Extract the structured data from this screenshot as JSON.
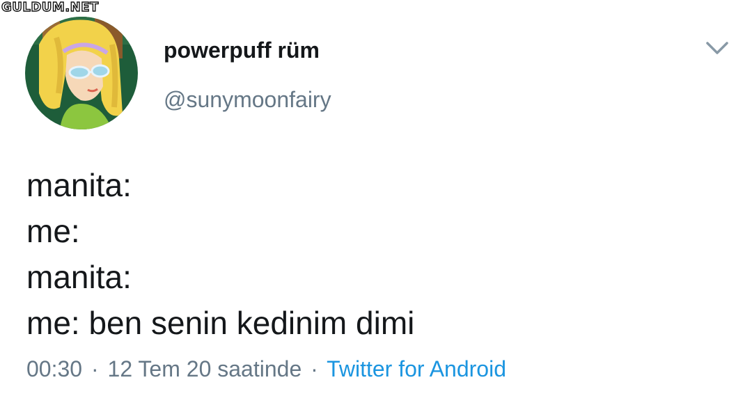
{
  "watermark": {
    "text": "GULDUM.NET"
  },
  "tweet": {
    "author": {
      "display_name": "powerpuff rüm",
      "handle": "@sunymoonfairy",
      "avatar_icon": "cartoon-girl-avatar-icon"
    },
    "menu_icon": "chevron-down-icon",
    "lines": [
      "manita:",
      "me:",
      "manita:",
      "me: ben senin kedinim dimi"
    ],
    "meta": {
      "time": "00:30",
      "separator": "·",
      "date": "12 Tem 20 saatinde",
      "source": "Twitter for Android"
    }
  },
  "colors": {
    "text": "#14171a",
    "secondary": "#657786",
    "link": "#1b95e0"
  }
}
